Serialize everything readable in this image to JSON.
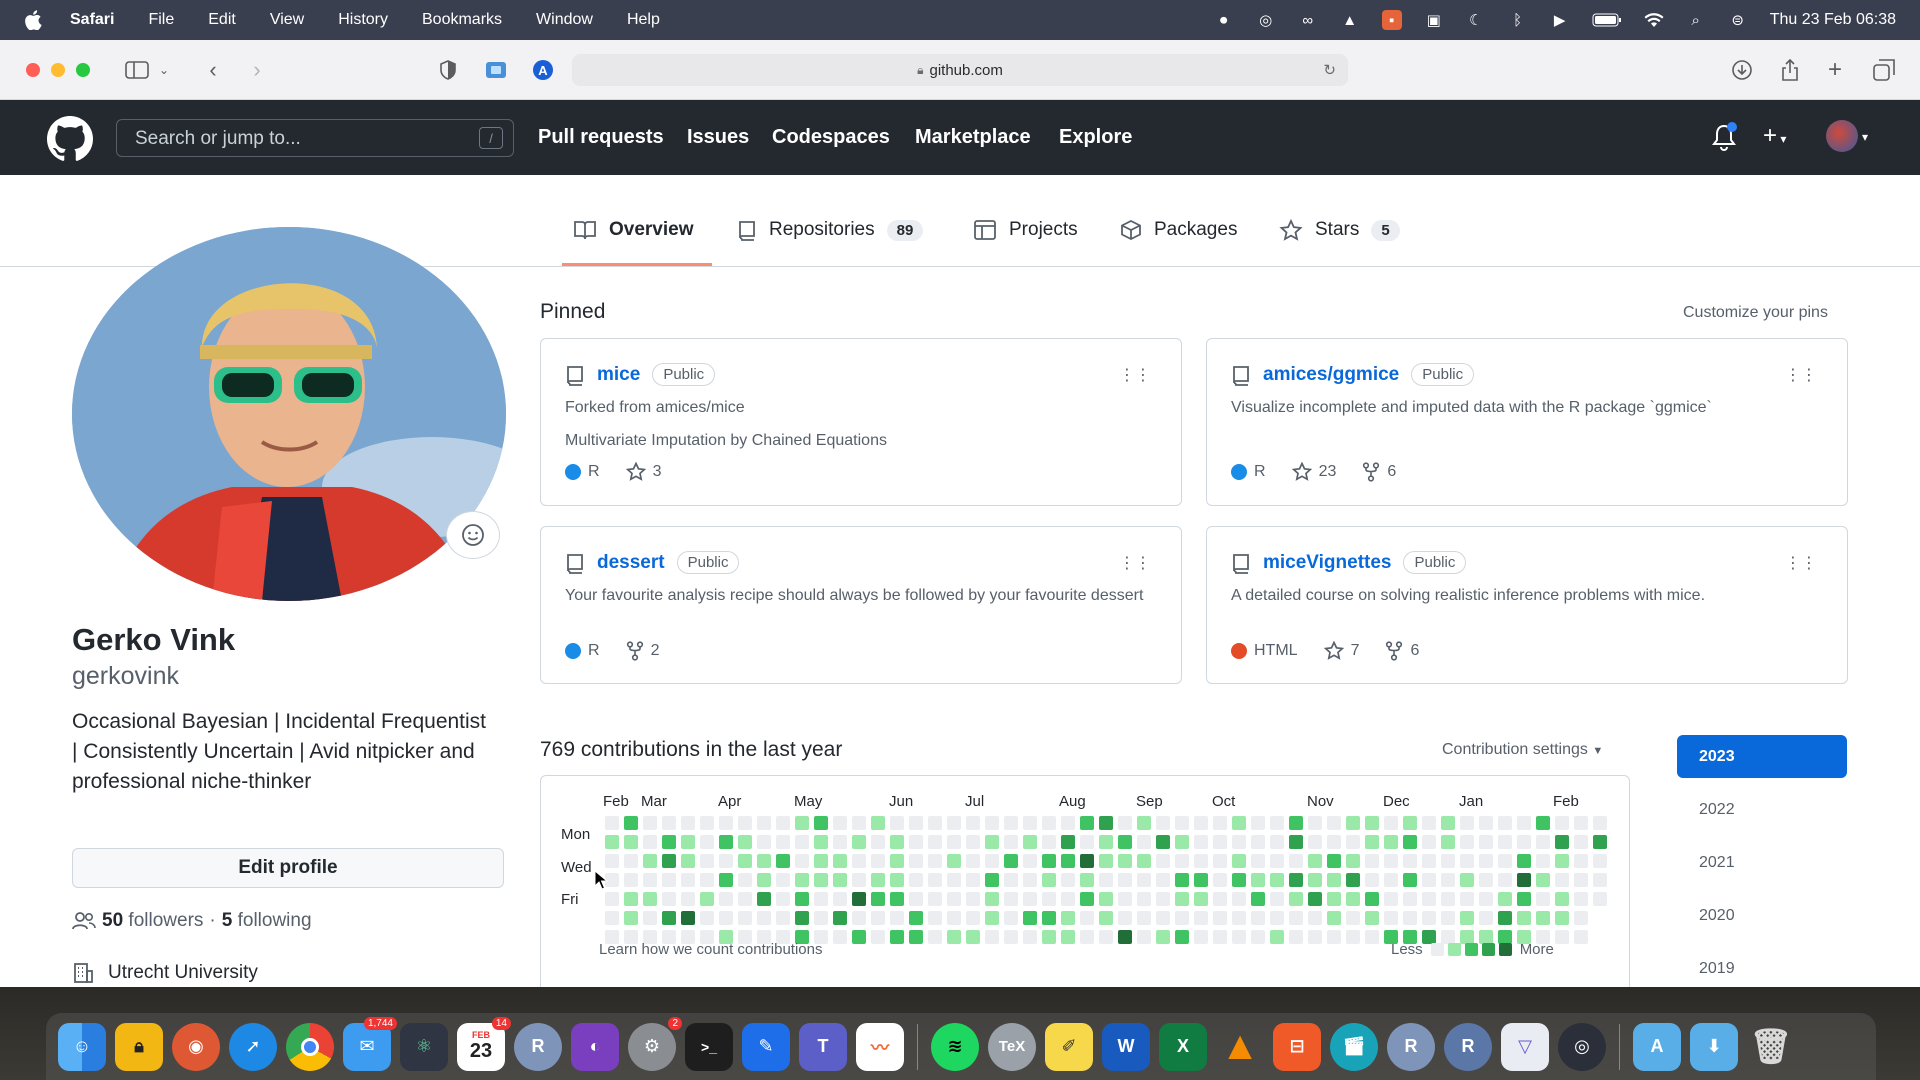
{
  "menubar": {
    "app_name": "Safari",
    "items": [
      "File",
      "Edit",
      "View",
      "History",
      "Bookmarks",
      "Window",
      "Help"
    ],
    "clock": "Thu 23 Feb  06:38"
  },
  "browser": {
    "url": "github.com"
  },
  "github": {
    "search_placeholder": "Search or jump to...",
    "search_hint": "/",
    "nav": [
      "Pull requests",
      "Issues",
      "Codespaces",
      "Marketplace",
      "Explore"
    ],
    "plus": "+"
  },
  "tabs": {
    "overview": "Overview",
    "repositories": "Repositories",
    "repositories_count": "89",
    "projects": "Projects",
    "packages": "Packages",
    "stars": "Stars",
    "stars_count": "5"
  },
  "profile": {
    "name": "Gerko Vink",
    "username": "gerkovink",
    "bio": "Occasional Bayesian | Incidental Frequentist | Consistently Uncertain | Avid nitpicker and professional niche-thinker",
    "edit_profile": "Edit profile",
    "followers_count": "50",
    "followers_label": "followers",
    "separator": "·",
    "following_count": "5",
    "following_label": "following",
    "organization": "Utrecht University"
  },
  "pinned": {
    "title": "Pinned",
    "customize": "Customize your pins",
    "repos": [
      {
        "name": "mice",
        "badge": "Public",
        "forked": "Forked from amices/mice",
        "description": "Multivariate Imputation by Chained Equations",
        "lang": "R",
        "lang_color": "#198CE7",
        "stars": "3",
        "forks": ""
      },
      {
        "name": "amices/ggmice",
        "badge": "Public",
        "forked": "",
        "description": "Visualize incomplete and imputed data with the R package `ggmice`",
        "lang": "R",
        "lang_color": "#198CE7",
        "stars": "23",
        "forks": "6"
      },
      {
        "name": "dessert",
        "badge": "Public",
        "forked": "",
        "description": "Your favourite analysis recipe should always be followed by your favourite dessert",
        "lang": "R",
        "lang_color": "#198CE7",
        "stars": "",
        "forks": "2"
      },
      {
        "name": "miceVignettes",
        "badge": "Public",
        "forked": "",
        "description": "A detailed course on solving realistic inference problems with mice.",
        "lang": "HTML",
        "lang_color": "#e34c26",
        "stars": "7",
        "forks": "6"
      }
    ]
  },
  "contributions": {
    "title": "769 contributions in the last year",
    "settings": "Contribution settings",
    "months": [
      "Feb",
      "Mar",
      "Apr",
      "May",
      "Jun",
      "Jul",
      "Aug",
      "Sep",
      "Oct",
      "Nov",
      "Dec",
      "Jan",
      "Feb"
    ],
    "days": [
      "Mon",
      "Wed",
      "Fri"
    ],
    "learn": "Learn how we count contributions",
    "less": "Less",
    "more": "More",
    "colors": [
      "#ebedf0",
      "#9be9a8",
      "#40c463",
      "#30a14e",
      "#216e39"
    ]
  },
  "years": [
    "2023",
    "2022",
    "2021",
    "2020",
    "2019"
  ],
  "dock": {
    "mail_badge": "1,744",
    "calendar_month": "FEB",
    "calendar_day": "23",
    "calendar_badge": "14",
    "settings_badge": "2"
  }
}
